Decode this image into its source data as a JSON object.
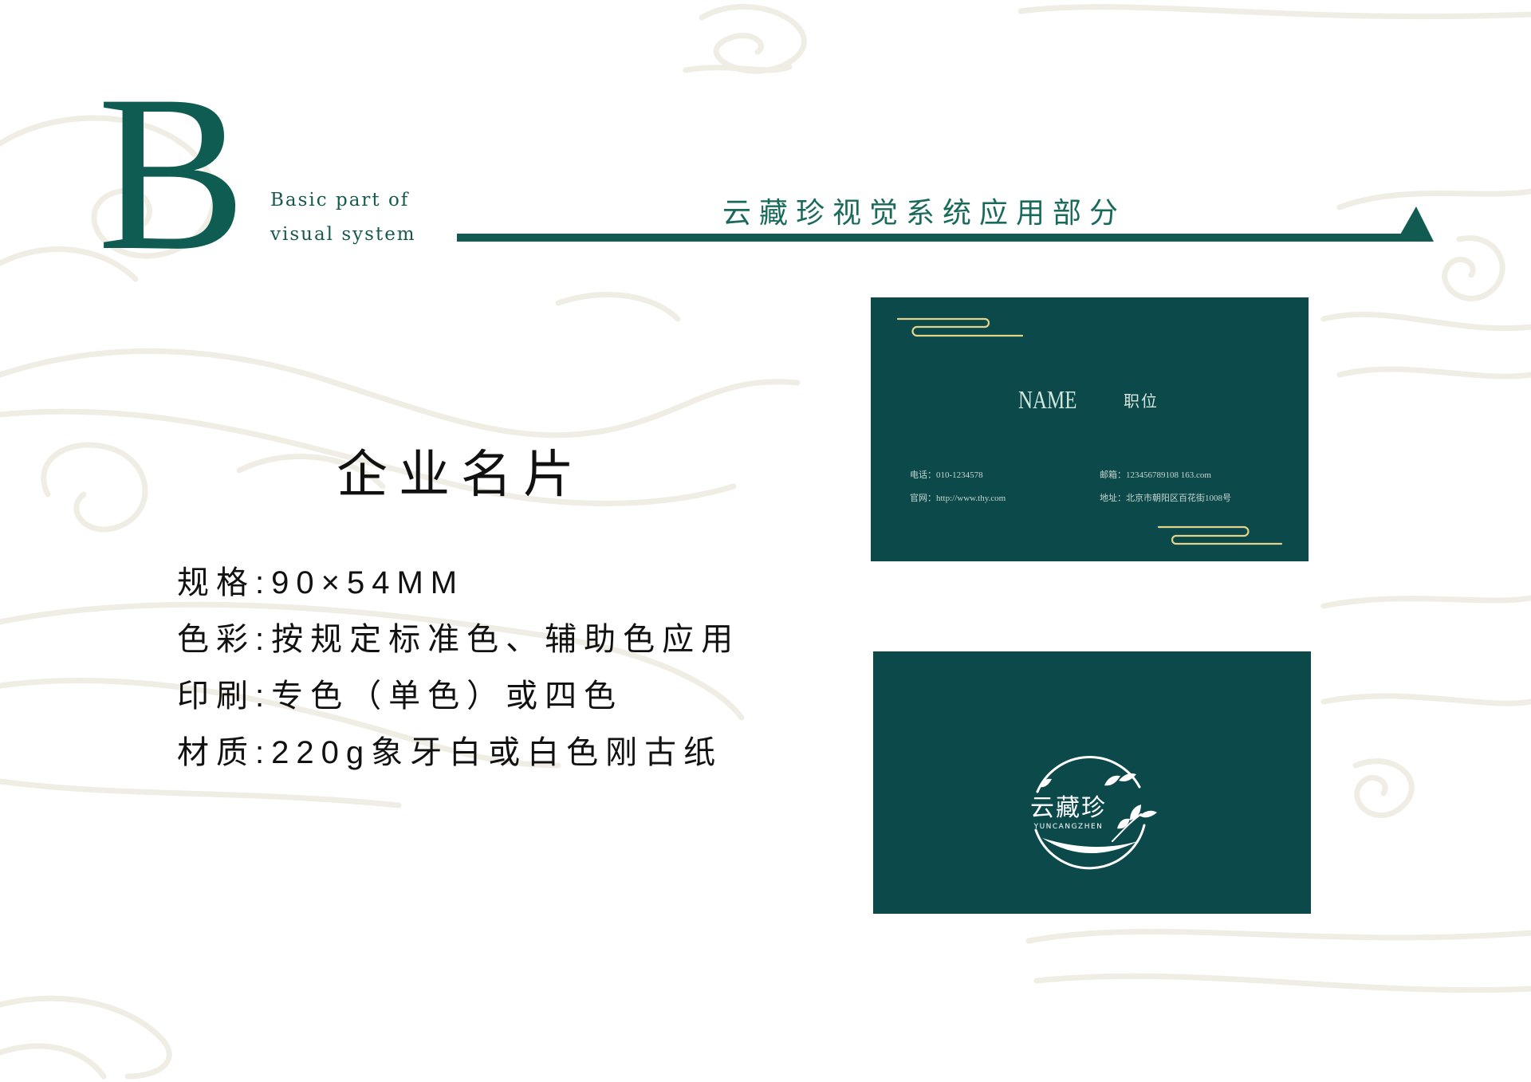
{
  "header": {
    "letter": "B",
    "subtitle_line1": "Basic part of",
    "subtitle_line2": "visual system",
    "section_title": "云藏珍视觉系统应用部分"
  },
  "content": {
    "title": "企业名片",
    "specs": [
      "规格:90×54MM",
      "色彩:按规定标准色、辅助色应用",
      "印刷:专色（单色）或四色",
      "材质:220g象牙白或白色刚古纸"
    ]
  },
  "card_front": {
    "name": "NAME",
    "position": "职位",
    "phone": "电话：010-1234578",
    "website": "官网：http://www.thy.com",
    "email": "邮箱：123456789108 163.com",
    "address": "地址：北京市朝阳区百花街1008号"
  },
  "card_back": {
    "logo_cn": "云藏珍",
    "logo_en": "YUNCANGZHEN"
  },
  "colors": {
    "brand_green": "#0f5c53",
    "card_green": "#0c494b",
    "accent_gold": "#e2d48a",
    "background": "#ffffff",
    "pattern": "#efede4"
  }
}
